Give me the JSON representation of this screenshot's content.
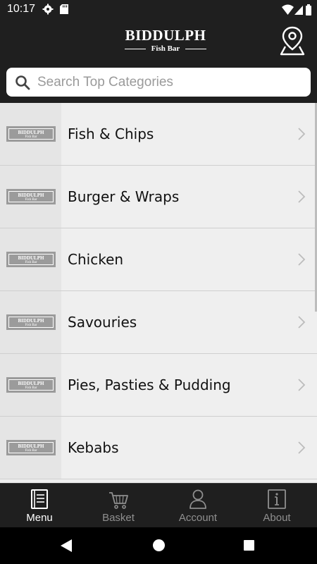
{
  "status_bar": {
    "time": "10:17",
    "icons": [
      "gear-icon",
      "sd-card-icon",
      "wifi-icon",
      "signal-icon",
      "battery-icon"
    ]
  },
  "header": {
    "logo_title": "BIDDULPH",
    "logo_subtitle": "Fish Bar",
    "location_icon": "map-pin-icon"
  },
  "search": {
    "placeholder": "Search Top Categories",
    "value": ""
  },
  "categories": [
    {
      "label": "Fish & Chips",
      "thumb_title": "BIDDULPH",
      "thumb_sub": "Fish Bar"
    },
    {
      "label": "Burger & Wraps",
      "thumb_title": "BIDDULPH",
      "thumb_sub": "Fish Bar"
    },
    {
      "label": "Chicken",
      "thumb_title": "BIDDULPH",
      "thumb_sub": "Fish Bar"
    },
    {
      "label": "Savouries",
      "thumb_title": "BIDDULPH",
      "thumb_sub": "Fish Bar"
    },
    {
      "label": "Pies, Pasties & Pudding",
      "thumb_title": "BIDDULPH",
      "thumb_sub": "Fish Bar"
    },
    {
      "label": "Kebabs",
      "thumb_title": "BIDDULPH",
      "thumb_sub": "Fish Bar"
    }
  ],
  "tabs": [
    {
      "label": "Menu",
      "icon": "menu-book-icon",
      "active": true
    },
    {
      "label": "Basket",
      "icon": "cart-icon",
      "active": false
    },
    {
      "label": "Account",
      "icon": "user-icon",
      "active": false
    },
    {
      "label": "About",
      "icon": "info-icon",
      "active": false
    }
  ],
  "colors": {
    "header_bg": "#1f1f1f",
    "list_bg": "#efefef",
    "thumb_logo": "#9b9b9b",
    "tab_inactive": "#8f8f8f",
    "tab_active": "#ffffff"
  }
}
